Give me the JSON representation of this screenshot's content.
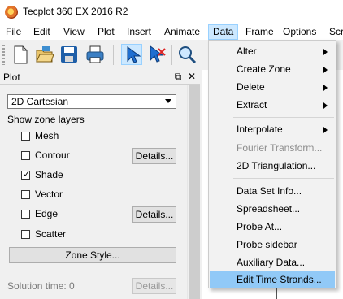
{
  "window": {
    "title": "Tecplot 360 EX 2016 R2"
  },
  "menubar": {
    "items": [
      "File",
      "Edit",
      "View",
      "Plot",
      "Insert",
      "Animate",
      "Data",
      "Frame",
      "Options",
      "Scr"
    ],
    "active": "Data"
  },
  "toolbar": {
    "buttons": [
      "new-document-icon",
      "open-folder-icon",
      "save-disk-icon",
      "print-icon",
      "select-pointer-icon",
      "adjust-pointer-icon",
      "zoom-magnifier-icon"
    ]
  },
  "panel": {
    "title": "Plot",
    "plot_type": "2D Cartesian",
    "zone_layers_label": "Show zone layers",
    "layers": [
      {
        "label": "Mesh",
        "checked": false
      },
      {
        "label": "Contour",
        "checked": false,
        "details": "Details..."
      },
      {
        "label": "Shade",
        "checked": true
      },
      {
        "label": "Vector",
        "checked": false
      },
      {
        "label": "Edge",
        "checked": false,
        "details": "Details..."
      },
      {
        "label": "Scatter",
        "checked": false
      }
    ],
    "zone_style_button": "Zone Style...",
    "solution_time_label": "Solution time:",
    "solution_time_value": "0",
    "solution_details_button": "Details..."
  },
  "data_menu": {
    "items": [
      {
        "label": "Alter",
        "submenu": true
      },
      {
        "label": "Create Zone",
        "submenu": true
      },
      {
        "label": "Delete",
        "submenu": true
      },
      {
        "label": "Extract",
        "submenu": true
      },
      {
        "label": "Interpolate",
        "submenu": true
      },
      {
        "label": "Fourier Transform...",
        "disabled": true
      },
      {
        "label": "2D Triangulation..."
      },
      {
        "label": "Data Set Info..."
      },
      {
        "label": "Spreadsheet..."
      },
      {
        "label": "Probe At..."
      },
      {
        "label": "Probe sidebar"
      },
      {
        "label": "Auxiliary Data..."
      },
      {
        "label": "Edit Time Strands...",
        "highlighted": true
      }
    ]
  }
}
